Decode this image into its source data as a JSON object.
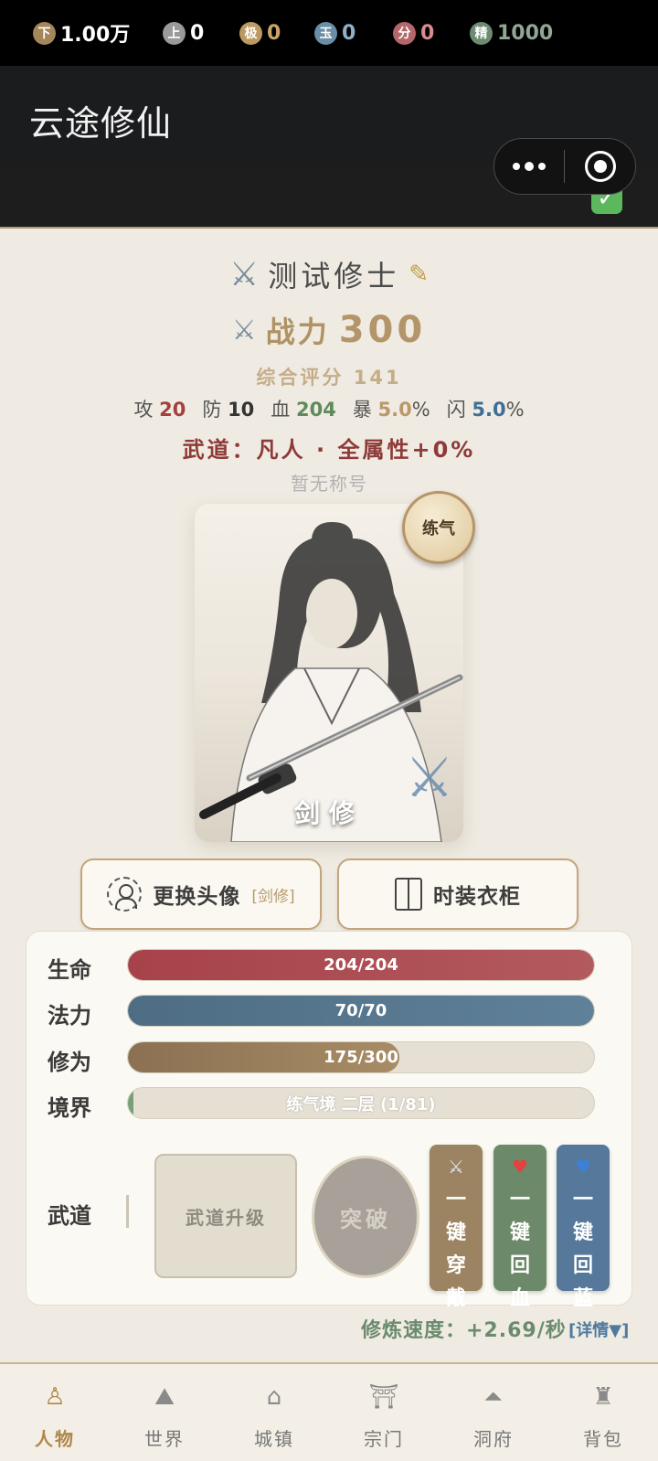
{
  "app_title": "云途修仙",
  "resources": [
    {
      "badge": "下",
      "value": "1.00万",
      "badge_color": "#a5865a",
      "value_color": "#ffffff"
    },
    {
      "badge": "上",
      "value": "0",
      "badge_color": "#9a9a9a",
      "value_color": "#ffffff"
    },
    {
      "badge": "极",
      "value": "0",
      "badge_color": "#bd9a63",
      "value_color": "#c9a56a"
    },
    {
      "badge": "玉",
      "value": "0",
      "badge_color": "#6a8ea6",
      "value_color": "#8fb1c9"
    },
    {
      "badge": "分",
      "value": "0",
      "badge_color": "#b4676b",
      "value_color": "#d98c8f"
    },
    {
      "badge": "精",
      "value": "1000",
      "badge_color": "#6e8a72",
      "value_color": "#8fa793"
    }
  ],
  "player": {
    "name": "测试修士",
    "power_label": "战力",
    "power_value": "300",
    "score": "综合评分 141",
    "stats": [
      {
        "label": "攻",
        "value": "20",
        "color": "#a4403e",
        "suffix": ""
      },
      {
        "label": "防",
        "value": "10",
        "color": "#333333",
        "suffix": ""
      },
      {
        "label": "血",
        "value": "204",
        "color": "#5f8a5d",
        "suffix": ""
      },
      {
        "label": "暴",
        "value": "5.0",
        "color": "#b9986a",
        "suffix": "%"
      },
      {
        "label": "闪",
        "value": "5.0",
        "color": "#3f6e97",
        "suffix": "%"
      }
    ],
    "wudao_line": "武道：凡人 · 全属性+0%",
    "title": "暂无称号",
    "portrait_label": "剑修",
    "realm_badge": "练气"
  },
  "actions": {
    "change_avatar": "更换头像",
    "change_avatar_tag": "[剑修]",
    "wardrobe": "时装衣柜"
  },
  "bars": [
    {
      "label": "生命",
      "text": "204/204",
      "fill": 1.0,
      "color": "#a7424a",
      "color2": "#b35a5e",
      "text_color": "#ffffff"
    },
    {
      "label": "法力",
      "text": "70/70",
      "fill": 1.0,
      "color": "#4e6d84",
      "color2": "#5f8199",
      "text_color": "#ffffff"
    },
    {
      "label": "修为",
      "text": "175/300",
      "fill": 0.583,
      "color": "#8b7152",
      "color2": "#a88c66",
      "text_color": "#ffffff"
    },
    {
      "label": "境界",
      "text": "练气境 二层 (1/81)",
      "fill": 0.012,
      "color": "#76a077",
      "color2": "#76a077",
      "text_color": "#ffffff"
    }
  ],
  "wudao_section": {
    "label": "武道",
    "upgrade": "武道升级",
    "breakthrough": "突破"
  },
  "quick_buttons": [
    {
      "icon": "⚔",
      "chars": [
        "一",
        "键",
        "穿",
        "戴"
      ],
      "color": "#9c8361"
    },
    {
      "icon": "♥",
      "chars": [
        "一",
        "键",
        "回",
        "血"
      ],
      "color": "#6c8a69"
    },
    {
      "icon": "♥",
      "chars": [
        "一",
        "键",
        "回",
        "蓝"
      ],
      "color": "#56789a"
    }
  ],
  "cultivation": {
    "speed": "修炼速度：+2.69/秒",
    "detail": "[详情▼]"
  },
  "tabs": [
    {
      "label": "人物",
      "icon": "person-icon",
      "active": true
    },
    {
      "label": "世界",
      "icon": "mountain-icon",
      "active": false
    },
    {
      "label": "城镇",
      "icon": "town-icon",
      "active": false
    },
    {
      "label": "宗门",
      "icon": "gate-icon",
      "active": false
    },
    {
      "label": "洞府",
      "icon": "cave-icon",
      "active": false
    },
    {
      "label": "背包",
      "icon": "bag-icon",
      "active": false
    }
  ]
}
